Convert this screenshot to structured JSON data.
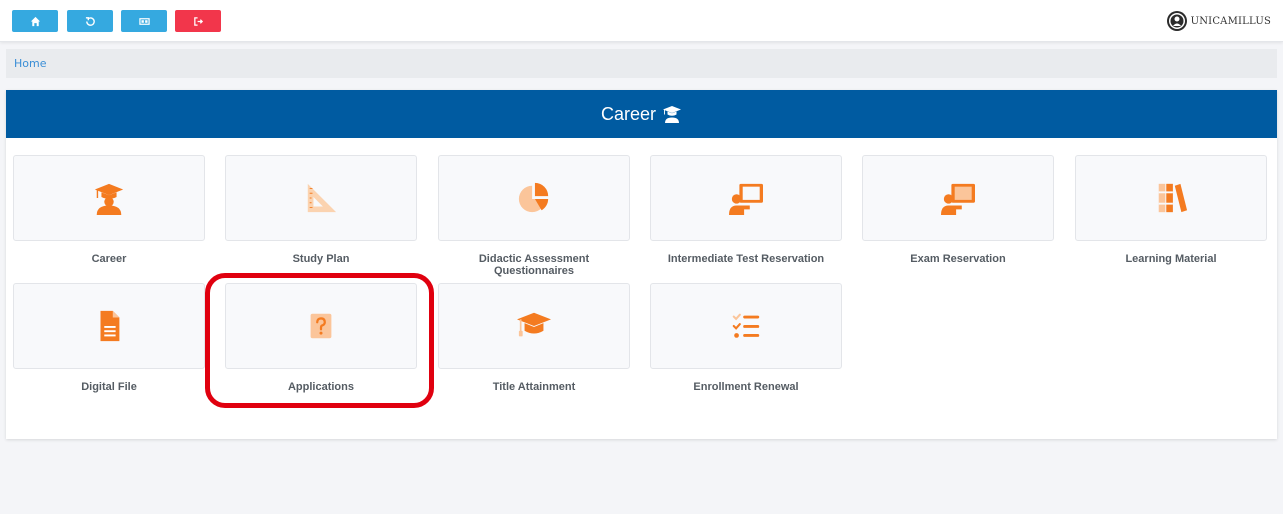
{
  "breadcrumb": {
    "home": "Home"
  },
  "panel": {
    "title": "Career"
  },
  "logo": {
    "text": "UNICAMILLUS"
  },
  "tiles": [
    {
      "label": "Career",
      "icon": "student-icon"
    },
    {
      "label": "Study Plan",
      "icon": "set-square-icon"
    },
    {
      "label": "Didactic Assessment Questionnaires",
      "icon": "pie-chart-icon"
    },
    {
      "label": "Intermediate Test Reservation",
      "icon": "teacher-board-icon"
    },
    {
      "label": "Exam Reservation",
      "icon": "teacher-board-icon"
    },
    {
      "label": "Learning Material",
      "icon": "books-icon"
    },
    {
      "label": "Digital File",
      "icon": "document-icon"
    },
    {
      "label": "Applications",
      "icon": "question-icon"
    },
    {
      "label": "Title Attainment",
      "icon": "graduation-cap-icon"
    },
    {
      "label": "Enrollment Renewal",
      "icon": "checklist-icon"
    }
  ],
  "colors": {
    "toolbar": "#35a9e0",
    "logout": "#f2364b",
    "header": "#005ba1",
    "icon": "#f47b20",
    "highlight": "#e0000f"
  }
}
